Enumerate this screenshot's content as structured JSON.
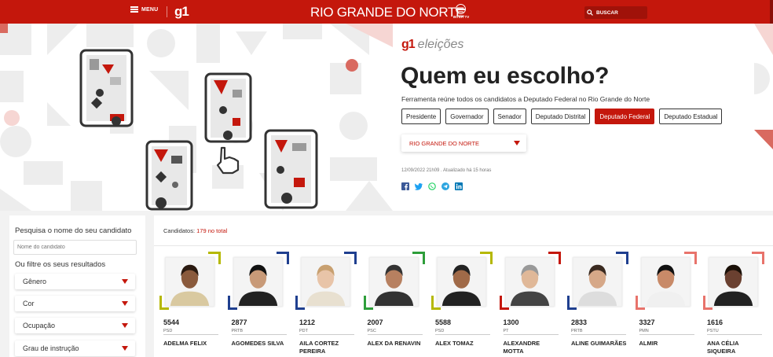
{
  "topbar": {
    "menu_label": "MENU",
    "logo": "g1",
    "region": "RIO GRANDE DO NORTE",
    "affiliate": "INTER TV",
    "search_label": "BUSCAR"
  },
  "hero": {
    "brand_g1": "g1",
    "brand_eleicoes": "eleições",
    "title": "Quem eu escolho?",
    "description": "Ferramenta reúne todos os candidatos a Deputado Federal no Rio Grande do Norte",
    "offices": [
      "Presidente",
      "Governador",
      "Senador",
      "Deputado Distrital",
      "Deputado Federal",
      "Deputado Estadual"
    ],
    "active_office": "Deputado Federal",
    "state_selected": "RIO GRANDE DO NORTE",
    "date": "12/09/2022 21h09 . Atualizado há 15 horas",
    "share": [
      "facebook-icon",
      "twitter-icon",
      "whatsapp-icon",
      "telegram-icon",
      "linkedin-icon"
    ]
  },
  "sidebar": {
    "search_label": "Pesquisa o nome do seu candidato",
    "search_placeholder": "Nome do candidato",
    "filter_label": "Ou filtre os seus resultados",
    "filters": [
      "Gênero",
      "Cor",
      "Ocupação",
      "Grau de instrução"
    ]
  },
  "results": {
    "count_prefix": "Candidatos:",
    "count_value": "179 no total"
  },
  "candidates": [
    {
      "number": "5544",
      "party": "PSD",
      "name": "ADELMA FELIX",
      "color": "#b5b800"
    },
    {
      "number": "2877",
      "party": "PRTB",
      "name": "AGOMEDES SILVA",
      "color": "#1f3f8f"
    },
    {
      "number": "1212",
      "party": "PDT",
      "name": "AILA CORTEZ PEREIRA",
      "color": "#1f3f8f"
    },
    {
      "number": "2007",
      "party": "PSC",
      "name": "ALEX DA RENAVIN",
      "color": "#2e9e3a"
    },
    {
      "number": "5588",
      "party": "PSD",
      "name": "ALEX TOMAZ",
      "color": "#b5b800"
    },
    {
      "number": "1300",
      "party": "PT",
      "name": "ALEXANDRE MOTTA",
      "color": "#c4170c"
    },
    {
      "number": "2833",
      "party": "PRTB",
      "name": "ALINE GUIMARÃES",
      "color": "#1f3f8f"
    },
    {
      "number": "3327",
      "party": "PMN",
      "name": "ALMIR",
      "color": "#e8736b"
    },
    {
      "number": "1616",
      "party": "PSTU",
      "name": "ANA CÉLIA SIQUEIRA",
      "color": "#e8736b"
    }
  ]
}
